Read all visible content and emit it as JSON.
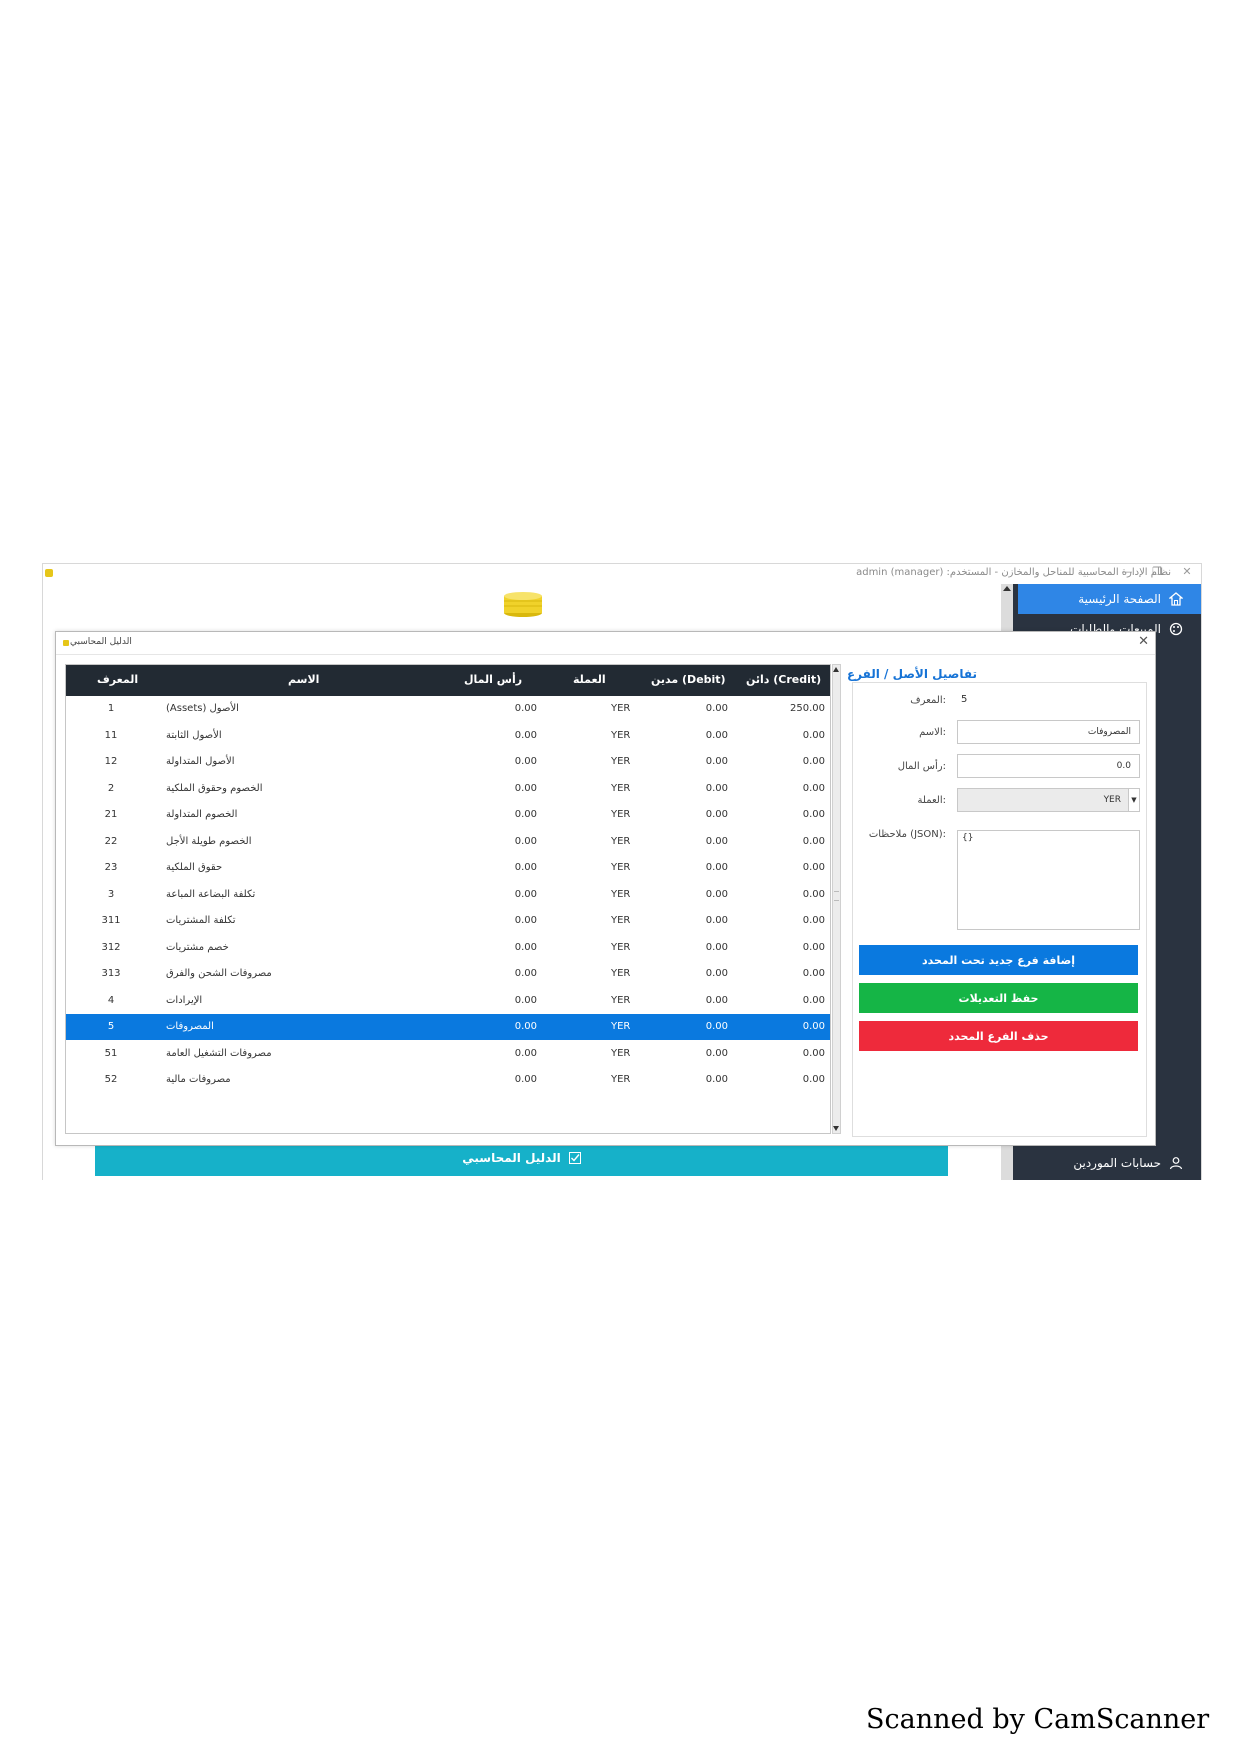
{
  "window": {
    "title": "نظام الإدارة المحاسبية للمناحل والمخازن - المستخدم: admin (manager)",
    "controls": [
      "—",
      "❐",
      "✕"
    ]
  },
  "sidebar": {
    "items": [
      {
        "label": "الصفحة الرئيسية",
        "icon": "home-icon",
        "active": true
      },
      {
        "label": "المبيعات والطلبات",
        "icon": "palette-icon",
        "active": false
      },
      {
        "label": "حسابات الموردين",
        "icon": "user-icon",
        "active": false
      }
    ]
  },
  "bottom_bar": {
    "label": "الدليل المحاسبي"
  },
  "dialog": {
    "title": "الدليل المحاسبي",
    "close": "✕"
  },
  "table": {
    "columns": {
      "id": "المعرف",
      "name": "الاسم",
      "capital": "رأس المال",
      "currency": "العملة",
      "debit": "مدين (Debit)",
      "credit": "دائن (Credit)"
    },
    "rows": [
      {
        "id": "1",
        "name": "الأصول (Assets)",
        "capital": "0.00",
        "currency": "YER",
        "debit": "0.00",
        "credit": "250.00"
      },
      {
        "id": "11",
        "name": "الأصول الثابتة",
        "capital": "0.00",
        "currency": "YER",
        "debit": "0.00",
        "credit": "0.00"
      },
      {
        "id": "12",
        "name": "الأصول المتداولة",
        "capital": "0.00",
        "currency": "YER",
        "debit": "0.00",
        "credit": "0.00"
      },
      {
        "id": "2",
        "name": "الخصوم وحقوق الملكية",
        "capital": "0.00",
        "currency": "YER",
        "debit": "0.00",
        "credit": "0.00"
      },
      {
        "id": "21",
        "name": "الخصوم المتداولة",
        "capital": "0.00",
        "currency": "YER",
        "debit": "0.00",
        "credit": "0.00"
      },
      {
        "id": "22",
        "name": "الخصوم طويلة الأجل",
        "capital": "0.00",
        "currency": "YER",
        "debit": "0.00",
        "credit": "0.00"
      },
      {
        "id": "23",
        "name": "حقوق الملكية",
        "capital": "0.00",
        "currency": "YER",
        "debit": "0.00",
        "credit": "0.00"
      },
      {
        "id": "3",
        "name": "تكلفة البضاعة المباعة",
        "capital": "0.00",
        "currency": "YER",
        "debit": "0.00",
        "credit": "0.00"
      },
      {
        "id": "311",
        "name": "تكلفة المشتريات",
        "capital": "0.00",
        "currency": "YER",
        "debit": "0.00",
        "credit": "0.00"
      },
      {
        "id": "312",
        "name": "خصم مشتريات",
        "capital": "0.00",
        "currency": "YER",
        "debit": "0.00",
        "credit": "0.00"
      },
      {
        "id": "313",
        "name": "مصروفات الشحن والفرق",
        "capital": "0.00",
        "currency": "YER",
        "debit": "0.00",
        "credit": "0.00"
      },
      {
        "id": "4",
        "name": "الإيرادات",
        "capital": "0.00",
        "currency": "YER",
        "debit": "0.00",
        "credit": "0.00"
      },
      {
        "id": "5",
        "name": "المصروفات",
        "capital": "0.00",
        "currency": "YER",
        "debit": "0.00",
        "credit": "0.00",
        "selected": true
      },
      {
        "id": "51",
        "name": "مصروفات التشغيل العامة",
        "capital": "0.00",
        "currency": "YER",
        "debit": "0.00",
        "credit": "0.00"
      },
      {
        "id": "52",
        "name": "مصروفات مالية",
        "capital": "0.00",
        "currency": "YER",
        "debit": "0.00",
        "credit": "0.00"
      }
    ]
  },
  "details": {
    "title": "تفاصيل الأصل / الفرع",
    "id_label": "المعرف:",
    "id_value": "5",
    "name_label": "الاسم:",
    "name_value": "المصروفات",
    "capital_label": "رأس المال:",
    "capital_value": "0.0",
    "currency_label": "العملة:",
    "currency_value": "YER",
    "notes_label": "ملاحظات (JSON):",
    "notes_value": "{}",
    "add_button": "إضافة فرع جديد تحت المحدد",
    "save_button": "حفظ التعديلات",
    "delete_button": "حذف الفرع المحدد"
  },
  "colors": {
    "add": "#0a79df",
    "save": "#15b546",
    "delete": "#ee2a3b",
    "header": "#222a33",
    "selected_row": "#0a79df",
    "sidebar": "#2a3340",
    "bottom_bar": "#16b1c9"
  },
  "footer": {
    "scanner": "Scanned by CamScanner"
  }
}
